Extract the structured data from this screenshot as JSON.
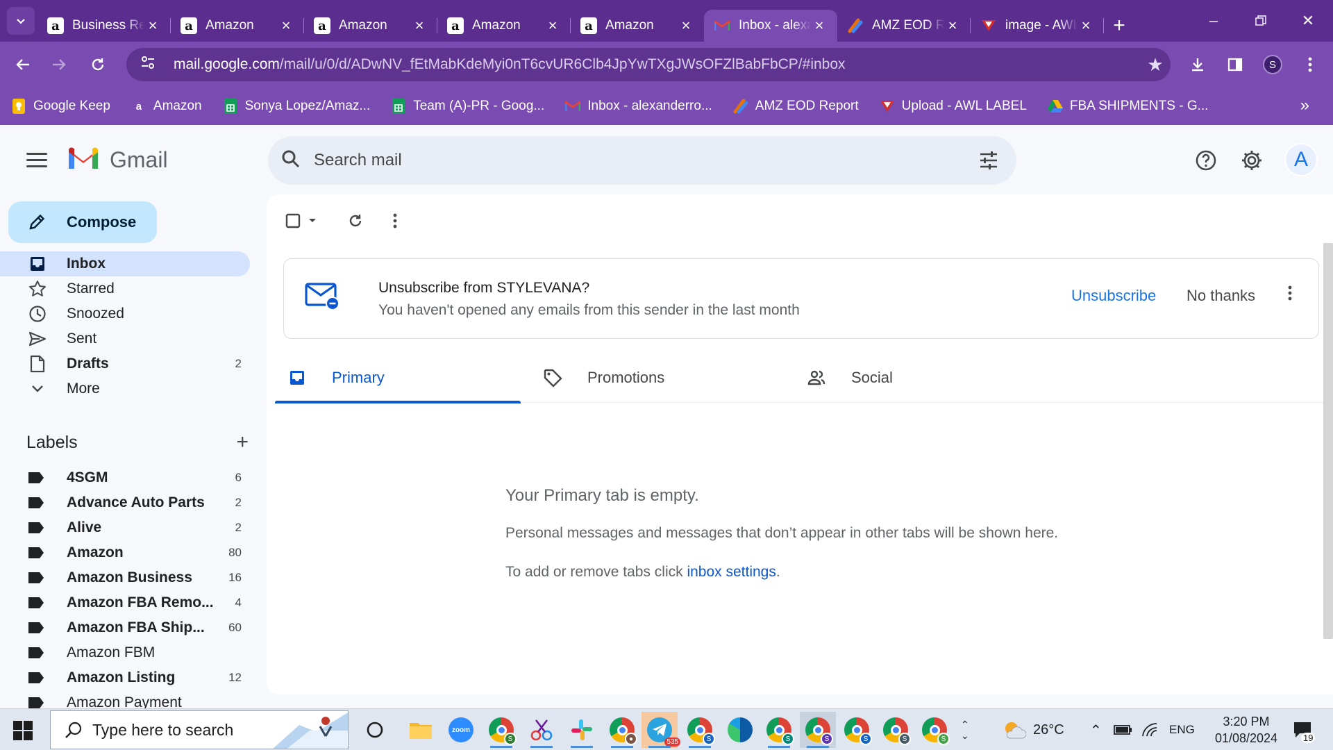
{
  "browser": {
    "tabs": [
      {
        "title": "Business Reports",
        "favicon": "amazon-icon"
      },
      {
        "title": "Amazon",
        "favicon": "amazon-icon"
      },
      {
        "title": "Amazon",
        "favicon": "amazon-icon"
      },
      {
        "title": "Amazon",
        "favicon": "amazon-icon"
      },
      {
        "title": "Amazon",
        "favicon": "amazon-icon"
      },
      {
        "title": "Inbox - alexanderro...",
        "favicon": "gmail-icon",
        "active": true
      },
      {
        "title": "AMZ EOD Report",
        "favicon": "amz-eod-icon"
      },
      {
        "title": "image - AWL",
        "favicon": "awl-icon"
      }
    ],
    "url_host": "mail.google.com",
    "url_path": "/mail/u/0/d/ADwNV_fEtMabKdeMyi0nT6cvUR6Clb4JpYwTXgJWsOFZlBabFbCP/#inbox",
    "profile_initial": "S",
    "bookmarks": [
      {
        "label": "Google Keep",
        "icon": "keep-icon"
      },
      {
        "label": "Amazon",
        "icon": "amazon-icon"
      },
      {
        "label": "Sonya Lopez/Amaz...",
        "icon": "sheets-icon"
      },
      {
        "label": "Team (A)-PR - Goog...",
        "icon": "sheets-icon"
      },
      {
        "label": "Inbox - alexanderro...",
        "icon": "gmail-icon"
      },
      {
        "label": "AMZ EOD Report",
        "icon": "amz-eod-icon"
      },
      {
        "label": "Upload - AWL LABEL",
        "icon": "awl-icon"
      },
      {
        "label": "FBA SHIPMENTS - G...",
        "icon": "drive-icon"
      }
    ]
  },
  "gmail": {
    "brand": "Gmail",
    "search_placeholder": "Search mail",
    "avatar_initial": "A",
    "compose": "Compose",
    "nav": [
      {
        "label": "Inbox",
        "icon": "inbox-icon",
        "count": "",
        "active": true,
        "bold": true
      },
      {
        "label": "Starred",
        "icon": "star-icon",
        "count": ""
      },
      {
        "label": "Snoozed",
        "icon": "clock-icon",
        "count": ""
      },
      {
        "label": "Sent",
        "icon": "send-icon",
        "count": ""
      },
      {
        "label": "Drafts",
        "icon": "draft-icon",
        "count": "2",
        "bold": true
      },
      {
        "label": "More",
        "icon": "chevron-down-icon",
        "count": ""
      }
    ],
    "labels_title": "Labels",
    "labels": [
      {
        "label": "4SGM",
        "count": "6",
        "unread": true
      },
      {
        "label": "Advance Auto Parts",
        "count": "2",
        "unread": true
      },
      {
        "label": "Alive",
        "count": "2",
        "unread": true
      },
      {
        "label": "Amazon",
        "count": "80",
        "unread": true
      },
      {
        "label": "Amazon Business",
        "count": "16",
        "unread": true
      },
      {
        "label": "Amazon FBA Remo...",
        "count": "4",
        "unread": true
      },
      {
        "label": "Amazon FBA Ship...",
        "count": "60",
        "unread": true
      },
      {
        "label": "Amazon FBM",
        "count": "",
        "unread": false
      },
      {
        "label": "Amazon Listing",
        "count": "12",
        "unread": true
      },
      {
        "label": "Amazon Payment",
        "count": "",
        "unread": false
      }
    ],
    "unsubscribe": {
      "title": "Unsubscribe from STYLEVANA?",
      "subtitle": "You haven't opened any emails from this sender in the last month",
      "unsubscribe_label": "Unsubscribe",
      "no_thanks_label": "No thanks"
    },
    "tabs": [
      {
        "label": "Primary",
        "icon": "inbox-tab-icon",
        "active": true
      },
      {
        "label": "Promotions",
        "icon": "tag-icon"
      },
      {
        "label": "Social",
        "icon": "people-icon"
      }
    ],
    "empty": {
      "title": "Your Primary tab is empty.",
      "message": "Personal messages and messages that don’t appear in other tabs will be shown here.",
      "settings_prefix": "To add or remove tabs click ",
      "settings_link": "inbox settings",
      "settings_suffix": "."
    }
  },
  "taskbar": {
    "search_placeholder": "Type here to search",
    "telegram_badge": "535",
    "weather": "26°C",
    "language": "ENG",
    "time": "3:20 PM",
    "date": "01/08/2024",
    "notifications": "19"
  },
  "colors": {
    "browser_frame": "#5b2d8e",
    "browser_toolbar": "#7a4bb0",
    "compose_bg": "#c2e7ff",
    "active_nav": "#d3e3fd",
    "accent": "#0b57d0"
  }
}
